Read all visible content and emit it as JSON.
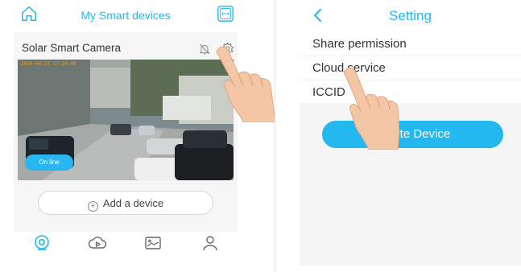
{
  "left_screen": {
    "title": "My Smart devices",
    "camera": {
      "name": "Solar Smart Camera",
      "timestamp": "2020-04-15 17:24:48",
      "status": "On line"
    },
    "add_device_label": "Add a device",
    "tabs": [
      "camera-tab-icon",
      "cloud-playback-tab-icon",
      "gallery-tab-icon",
      "profile-tab-icon"
    ]
  },
  "right_screen": {
    "title": "Setting",
    "menu_items": [
      "Share permission",
      "Cloud service",
      "ICCID"
    ],
    "delete_label": "Delete Device"
  },
  "colors": {
    "accent": "#21b7ea",
    "button": "#23b8ee",
    "status_badge": "#29b6f0",
    "panel_bg": "#f5f5f5"
  }
}
